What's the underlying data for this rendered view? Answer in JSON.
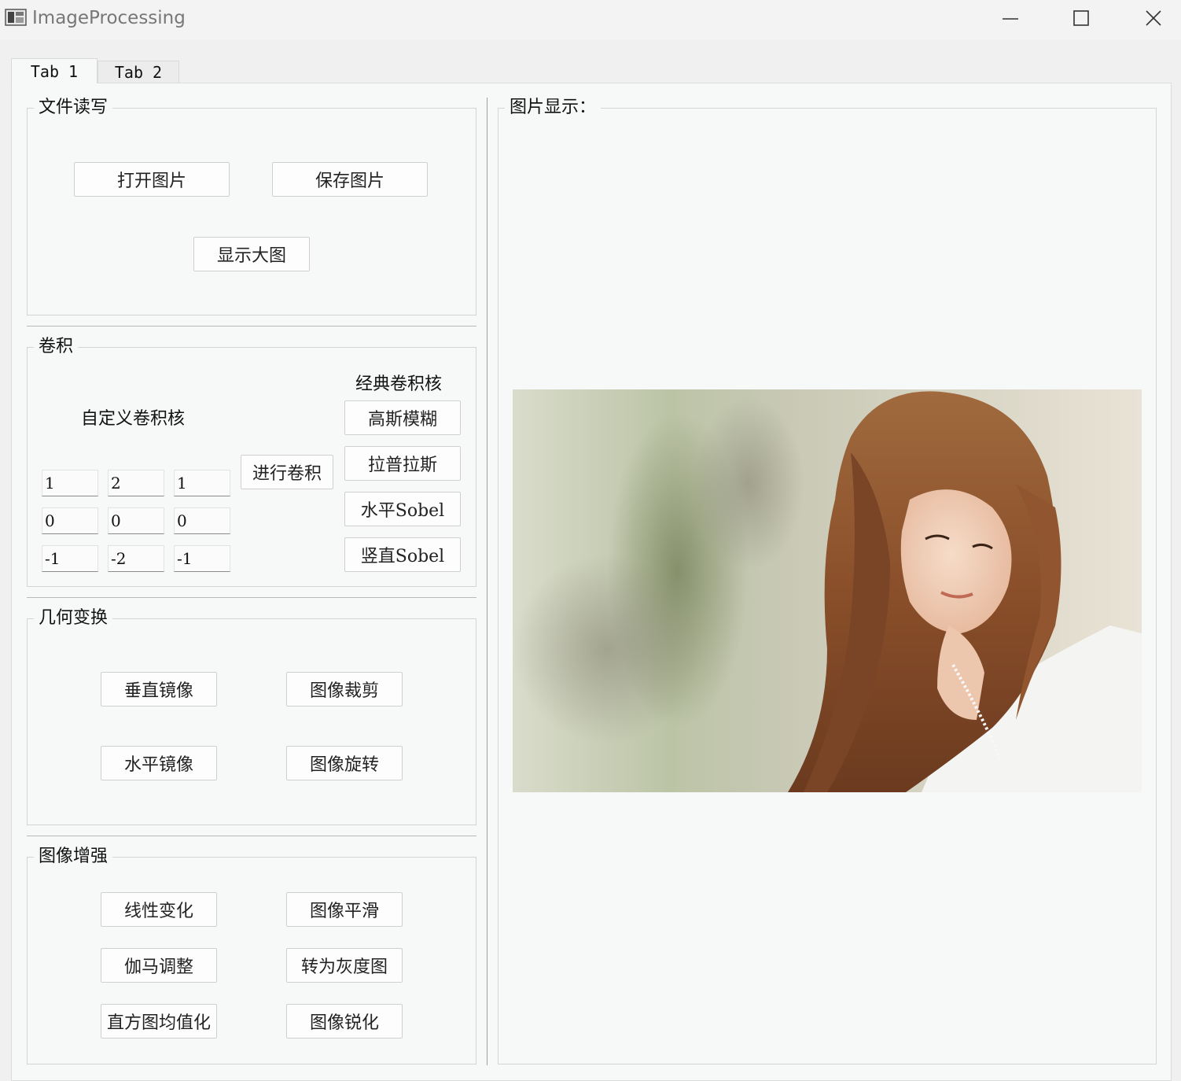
{
  "window": {
    "title": "ImageProcessing"
  },
  "tabs": [
    {
      "label": "Tab 1"
    },
    {
      "label": "Tab 2"
    }
  ],
  "file_io": {
    "title": "文件读写",
    "open_label": "打开图片",
    "save_label": "保存图片",
    "show_large_label": "显示大图"
  },
  "convolution": {
    "title": "卷积",
    "custom_kernel_label": "自定义卷积核",
    "classic_kernel_label": "经典卷积核",
    "kernel": [
      [
        "1",
        "2",
        "1"
      ],
      [
        "0",
        "0",
        "0"
      ],
      [
        "-1",
        "-2",
        "-1"
      ]
    ],
    "apply_label": "进行卷积",
    "gaussian_label": "高斯模糊",
    "laplace_label": "拉普拉斯",
    "sobel_h_label": "水平Sobel",
    "sobel_v_label": "竖直Sobel"
  },
  "geometry": {
    "title": "几何变换",
    "vertical_mirror_label": "垂直镜像",
    "crop_label": "图像裁剪",
    "horizontal_mirror_label": "水平镜像",
    "rotate_label": "图像旋转"
  },
  "enhance": {
    "title": "图像增强",
    "linear_label": "线性变化",
    "smooth_label": "图像平滑",
    "gamma_label": "伽马调整",
    "gray_label": "转为灰度图",
    "histeq_label": "直方图均值化",
    "sharpen_label": "图像锐化"
  },
  "display": {
    "title": "图片显示："
  },
  "icons": {
    "minimize": "minimize-icon",
    "maximize": "maximize-icon",
    "close": "close-icon",
    "app": "app-icon"
  }
}
